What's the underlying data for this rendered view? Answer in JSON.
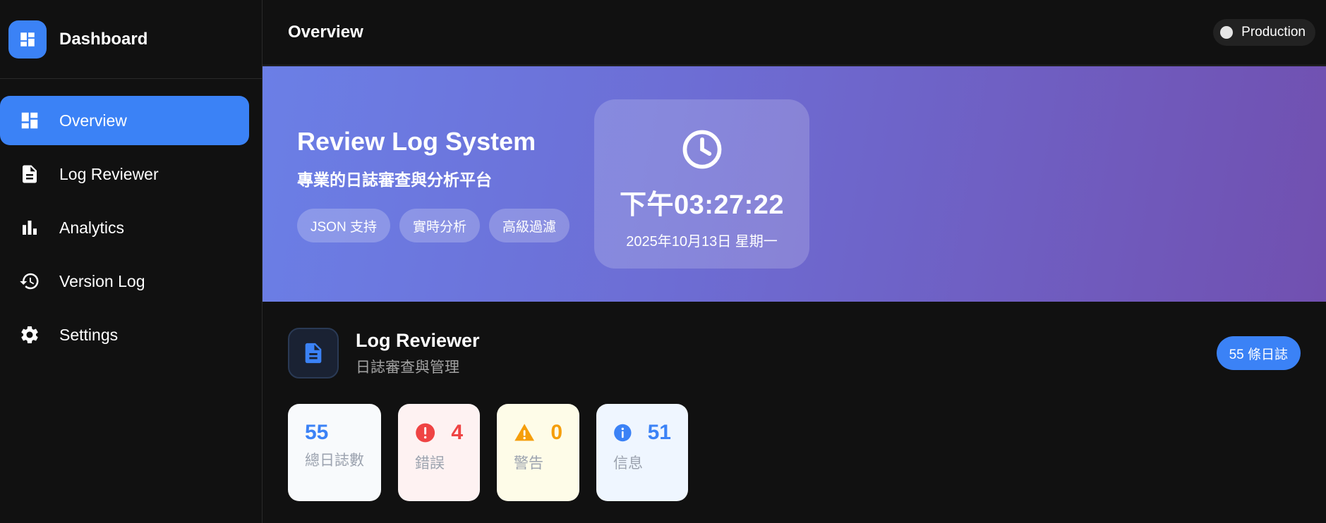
{
  "brand": {
    "title": "Dashboard",
    "icon": "dashboard-icon"
  },
  "sidebar": {
    "items": [
      {
        "label": "Overview",
        "icon": "dashboard-icon",
        "active": true
      },
      {
        "label": "Log Reviewer",
        "icon": "document-icon",
        "active": false
      },
      {
        "label": "Analytics",
        "icon": "bar-chart-icon",
        "active": false
      },
      {
        "label": "Version Log",
        "icon": "history-icon",
        "active": false
      },
      {
        "label": "Settings",
        "icon": "gear-icon",
        "active": false
      }
    ]
  },
  "header": {
    "title": "Overview",
    "env_label": "Production"
  },
  "hero": {
    "title": "Review Log System",
    "subtitle": "專業的日誌審查與分析平台",
    "chips": [
      "JSON 支持",
      "實時分析",
      "高級過濾"
    ],
    "clock": {
      "time": "下午03:27:22",
      "date": "2025年10月13日 星期一",
      "icon": "clock-icon"
    }
  },
  "section": {
    "title": "Log Reviewer",
    "subtitle": "日誌審查與管理",
    "count_label": "55 條日誌",
    "icon": "document-icon"
  },
  "stats": [
    {
      "value": "55",
      "label": "總日誌數",
      "icon": "",
      "color": "#3b82f6",
      "bg": "#f8fafc"
    },
    {
      "value": "4",
      "label": "錯誤",
      "icon": "error-icon",
      "color": "#ef4444",
      "bg": "#fef2f2"
    },
    {
      "value": "0",
      "label": "警告",
      "icon": "warning-icon",
      "color": "#f59e0b",
      "bg": "#fefce8"
    },
    {
      "value": "51",
      "label": "信息",
      "icon": "info-icon",
      "color": "#3b82f6",
      "bg": "#eff6ff"
    }
  ],
  "colors": {
    "accent": "#3b82f6",
    "sidebar_bg": "#111111"
  }
}
